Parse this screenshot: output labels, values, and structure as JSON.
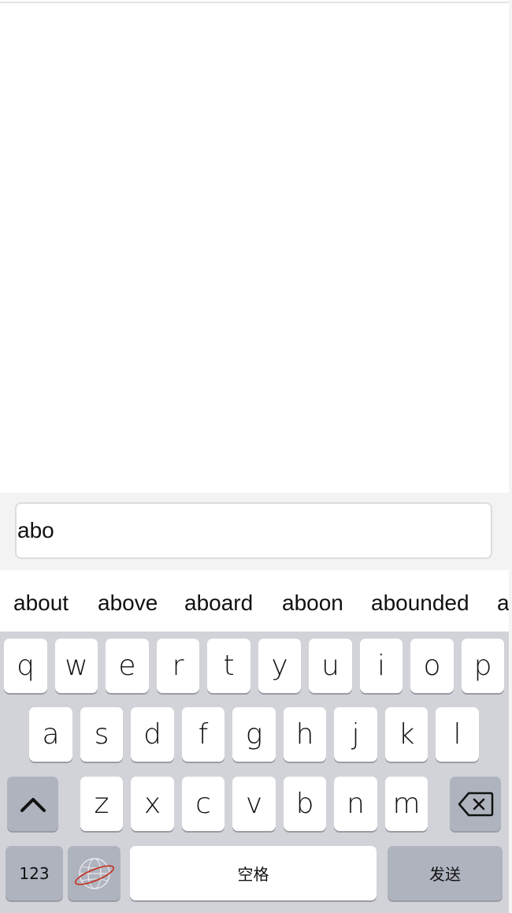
{
  "input": {
    "value": "abo"
  },
  "suggestions": [
    "about",
    "above",
    "aboard",
    "aboon",
    "abounded",
    "a"
  ],
  "keyboard": {
    "row1": [
      "q",
      "w",
      "e",
      "r",
      "t",
      "y",
      "u",
      "i",
      "o",
      "p"
    ],
    "row2": [
      "a",
      "s",
      "d",
      "f",
      "g",
      "h",
      "j",
      "k",
      "l"
    ],
    "row3": [
      "z",
      "x",
      "c",
      "v",
      "b",
      "n",
      "m"
    ],
    "numbers_label": "123",
    "space_label": "空格",
    "send_label": "发送"
  },
  "icons": {
    "shift": "shift-icon",
    "delete": "backspace-icon",
    "globe": "globe-icon"
  },
  "colors": {
    "keyboard_bg": "#d1d3d9",
    "key_bg": "#ffffff",
    "function_key_bg": "#aeb3be",
    "globe_accent": "#c0392b"
  }
}
